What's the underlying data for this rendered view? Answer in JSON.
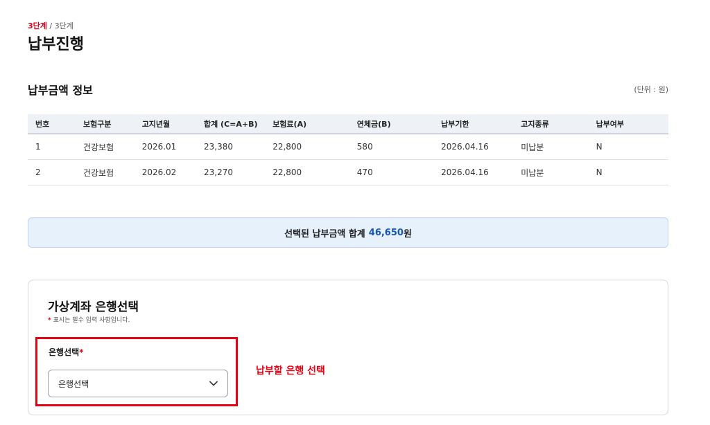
{
  "step": {
    "current": "3단계",
    "separator": " / ",
    "total": "3단계"
  },
  "page_title": "납부진행",
  "payment_info": {
    "title": "납부금액 정보",
    "unit": "(단위 : 원)",
    "columns": [
      "번호",
      "보험구분",
      "고지년월",
      "합계 (C=A+B)",
      "보험료(A)",
      "연체금(B)",
      "납부기한",
      "고지종류",
      "납부여부"
    ],
    "rows": [
      [
        "1",
        "건강보험",
        "2026.01",
        "23,380",
        "22,800",
        "580",
        "2026.04.16",
        "미납분",
        "N"
      ],
      [
        "2",
        "건강보험",
        "2026.02",
        "23,270",
        "22,800",
        "470",
        "2026.04.16",
        "미납분",
        "N"
      ]
    ]
  },
  "total": {
    "label": "선택된 납부금액 합계",
    "amount": "46,650",
    "currency": "원"
  },
  "bank_section": {
    "title": "가상계좌 은행선택",
    "required_star": "*",
    "required_note": "표시는 필수 입력 사항입니다.",
    "field_label": "은행선택",
    "field_star": "*",
    "select_value": "은행선택",
    "annotation": "납부할 은행 선택"
  },
  "colors": {
    "accent_red": "#e60012",
    "amount_blue": "#1a55b3",
    "total_bg": "#e7f1fc"
  }
}
